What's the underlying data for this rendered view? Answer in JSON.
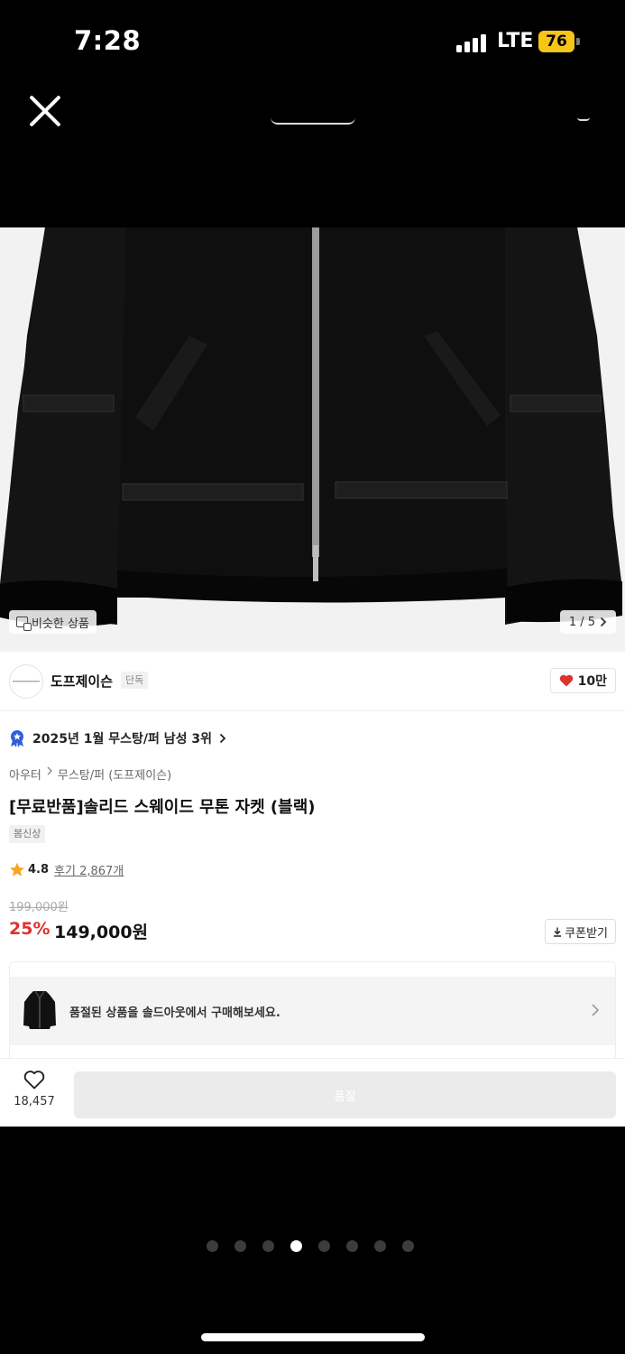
{
  "status_bar": {
    "time": "7:28",
    "network": "LTE",
    "battery": "76",
    "battery_color": "#f5c518"
  },
  "overlay": {
    "close_icon": "close-icon",
    "page_dots_count": 8,
    "active_dot_index": 3
  },
  "product_image": {
    "similar_label": "비슷한 상품",
    "page_counter": "1 / 5"
  },
  "brand": {
    "name": "도프제이슨",
    "badge": "단독",
    "like_count": "10만",
    "like_color": "#e03131"
  },
  "ranking": {
    "text": "2025년 1월 무스탕/퍼 남성 3위"
  },
  "breadcrumb": [
    "아우터",
    "무스탕/퍼 (도프제이슨)"
  ],
  "product": {
    "title": "[무료반품]솔리드 스웨이드 무톤 자켓 (블랙)",
    "tag": "봄신상",
    "rating": "4.8",
    "review_label": "후기 2,867개",
    "original_price": "199,000원",
    "discount": "25%",
    "sale_price": "149,000원",
    "coupon_label": "쿠폰받기",
    "discount_color": "#e03131"
  },
  "soldout_banner": {
    "text": "품절된 상품을 솔드아웃에서 구매해보세요."
  },
  "bottom_bar": {
    "wish_count": "18,457",
    "buy_label": "품절"
  }
}
